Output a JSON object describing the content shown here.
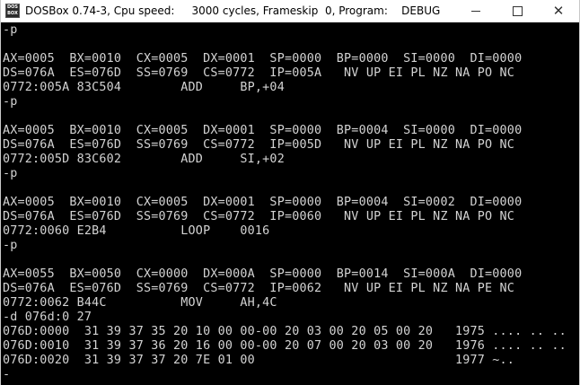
{
  "window": {
    "title": "DOSBox 0.74-3, Cpu speed:     3000 cycles, Frameskip  0, Program:    DEBUG",
    "icon_top": "DOS",
    "icon_bottom": "BOX"
  },
  "controls": {
    "minimize_icon": "minimize-icon",
    "maximize_icon": "maximize-icon",
    "close_glyph": "✕"
  },
  "colors": {
    "terminal_bg": "#000000",
    "terminal_fg": "#d3d3d3"
  },
  "lines": [
    "-p",
    "",
    "AX=0005  BX=0010  CX=0005  DX=0001  SP=0000  BP=0000  SI=0000  DI=0000",
    "DS=076A  ES=076D  SS=0769  CS=0772  IP=005A   NV UP EI PL NZ NA PO NC",
    "0772:005A 83C504        ADD     BP,+04",
    "-p",
    "",
    "AX=0005  BX=0010  CX=0005  DX=0001  SP=0000  BP=0004  SI=0000  DI=0000",
    "DS=076A  ES=076D  SS=0769  CS=0772  IP=005D   NV UP EI PL NZ NA PO NC",
    "0772:005D 83C602        ADD     SI,+02",
    "-p",
    "",
    "AX=0005  BX=0010  CX=0005  DX=0001  SP=0000  BP=0004  SI=0002  DI=0000",
    "DS=076A  ES=076D  SS=0769  CS=0772  IP=0060   NV UP EI PL NZ NA PO NC",
    "0772:0060 E2B4          LOOP    0016",
    "-p",
    "",
    "AX=0055  BX=0050  CX=0000  DX=000A  SP=0000  BP=0014  SI=000A  DI=0000",
    "DS=076A  ES=076D  SS=0769  CS=0772  IP=0062   NV UP EI PL NZ NA PE NC",
    "0772:0062 B44C          MOV     AH,4C",
    "-d 076d:0 27",
    "076D:0000  31 39 37 35 20 10 00 00-00 20 03 00 20 05 00 20   1975 .... .. ..",
    "076D:0010  31 39 37 36 20 16 00 00-00 20 07 00 20 03 00 20   1976 .... .. ..",
    "076D:0020  31 39 37 37 20 7E 01 00                           1977 ~..",
    "-"
  ]
}
